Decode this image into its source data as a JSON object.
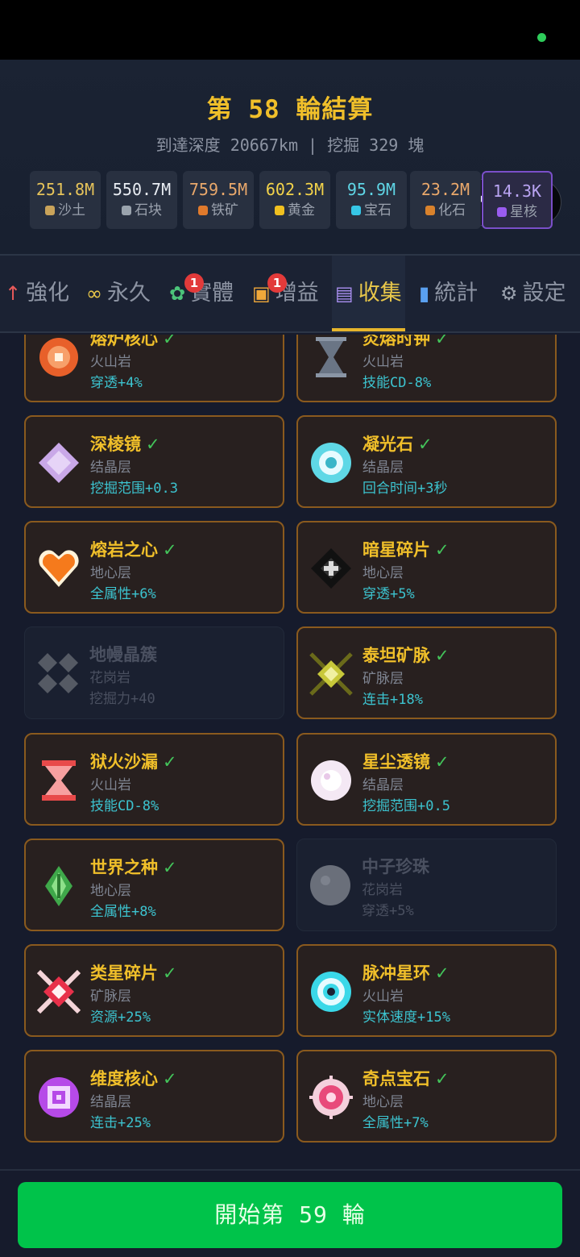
{
  "header": {
    "title": "第 58 輪結算",
    "subtitle": "到達深度 20667km | 挖掘 329 塊"
  },
  "resources": [
    {
      "value": "251.8M",
      "label": "沙土",
      "color": "#e6c35a",
      "dot": "#c9a35a"
    },
    {
      "value": "550.7M",
      "label": "石块",
      "color": "#e9edf3",
      "dot": "#9aa3ad"
    },
    {
      "value": "759.5M",
      "label": "铁矿",
      "color": "#e9a86b",
      "dot": "#e07a2c"
    },
    {
      "value": "602.3M",
      "label": "黄金",
      "color": "#f3d34a",
      "dot": "#f0c020"
    },
    {
      "value": "95.9M",
      "label": "宝石",
      "color": "#5fd6e6",
      "dot": "#36c6e6"
    },
    {
      "value": "23.2M",
      "label": "化石",
      "color": "#e9a86b",
      "dot": "#d9822c"
    },
    {
      "value": "14.3K",
      "label": "星核",
      "color": "#b9a4f2",
      "dot": "#9a5cf0"
    }
  ],
  "tabs": [
    {
      "icon": "↑",
      "label": "強化",
      "icon_color": "#e85a5a"
    },
    {
      "icon": "∞",
      "label": "永久",
      "icon_color": "#e8c74a"
    },
    {
      "icon": "✿",
      "label": "實體",
      "icon_color": "#4cc47a",
      "badge": "1"
    },
    {
      "icon": "▣",
      "label": "增益",
      "icon_color": "#f0a83a",
      "badge": "1"
    },
    {
      "icon": "▤",
      "label": "收集",
      "icon_color": "#a98ff0"
    },
    {
      "icon": "▮",
      "label": "統計",
      "icon_color": "#5aa0f0"
    },
    {
      "icon": "⚙",
      "label": "設定",
      "icon_color": "#9aa1ad"
    }
  ],
  "check_mark": "✓",
  "cards": [
    {
      "name": "熔炉核心",
      "layer": "火山岩",
      "effect": "穿透+4%",
      "collected": true,
      "gem": "#e8602a"
    },
    {
      "name": "炎熔时钟",
      "layer": "火山岩",
      "effect": "技能CD-8%",
      "collected": true,
      "gem": "#6a7585"
    },
    {
      "name": "深棱镜",
      "layer": "结晶层",
      "effect": "挖掘范围+0.3",
      "collected": true,
      "gem": "#c9a8e8"
    },
    {
      "name": "凝光石",
      "layer": "结晶层",
      "effect": "回合时间+3秒",
      "collected": true,
      "gem": "#5fd8e6"
    },
    {
      "name": "熔岩之心",
      "layer": "地心层",
      "effect": "全属性+6%",
      "collected": true,
      "gem": "#f57a1c"
    },
    {
      "name": "暗星碎片",
      "layer": "地心层",
      "effect": "穿透+5%",
      "collected": true,
      "gem": "#2a2a2a"
    },
    {
      "name": "地幔晶簇",
      "layer": "花岗岩",
      "effect": "挖掘力+40",
      "collected": false,
      "gem": "#5a5f6a"
    },
    {
      "name": "泰坦矿脉",
      "layer": "矿脉层",
      "effect": "连击+18%",
      "collected": true,
      "gem": "#c8c83a"
    },
    {
      "name": "狱火沙漏",
      "layer": "火山岩",
      "effect": "技能CD-8%",
      "collected": true,
      "gem": "#e84a4a"
    },
    {
      "name": "星尘透镜",
      "layer": "结晶层",
      "effect": "挖掘范围+0.5",
      "collected": true,
      "gem": "#f4e8f4"
    },
    {
      "name": "世界之种",
      "layer": "地心层",
      "effect": "全属性+8%",
      "collected": true,
      "gem": "#3fa84a"
    },
    {
      "name": "中子珍珠",
      "layer": "花岗岩",
      "effect": "穿透+5%",
      "collected": false,
      "gem": "#7a7f8a"
    },
    {
      "name": "类星碎片",
      "layer": "矿脉层",
      "effect": "资源+25%",
      "collected": true,
      "gem": "#e8304a"
    },
    {
      "name": "脉冲星环",
      "layer": "火山岩",
      "effect": "实体速度+15%",
      "collected": true,
      "gem": "#3ad8e8"
    },
    {
      "name": "维度核心",
      "layer": "结晶层",
      "effect": "连击+25%",
      "collected": true,
      "gem": "#b64ae8"
    },
    {
      "name": "奇点宝石",
      "layer": "地心层",
      "effect": "全属性+7%",
      "collected": true,
      "gem": "#e84a7a"
    }
  ],
  "footer": {
    "start_label": "開始第 59 輪"
  }
}
